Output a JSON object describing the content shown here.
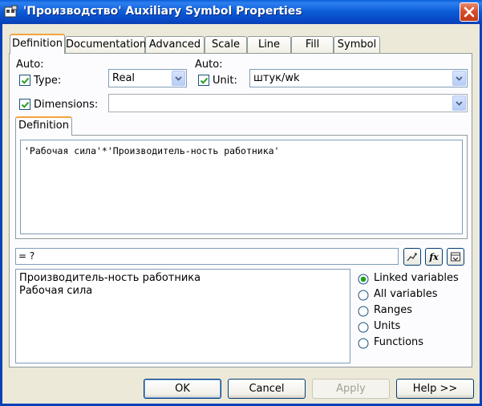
{
  "window": {
    "title": "'Производство' Auxiliary Symbol Properties"
  },
  "tabs": [
    {
      "label": "Definition",
      "active": true
    },
    {
      "label": "Documentation"
    },
    {
      "label": "Advanced"
    },
    {
      "label": "Scale"
    },
    {
      "label": "Line"
    },
    {
      "label": "Fill"
    },
    {
      "label": "Symbol"
    }
  ],
  "definition": {
    "auto_label_left": "Auto:",
    "auto_label_right": "Auto:",
    "type_label": "Type:",
    "type_checked": true,
    "type_value": "Real",
    "unit_label": "Unit:",
    "unit_checked": true,
    "unit_value": "штук/wk",
    "dimensions_label": "Dimensions:",
    "dimensions_checked": true,
    "dimensions_value": "",
    "inner_tab": "Definition",
    "equation": "'Рабочая сила'*'Производитель-ность работника'",
    "result": "= ?",
    "variables": [
      "Производитель-ность работника",
      "Рабочая сила"
    ],
    "radio_options": [
      {
        "label": "Linked variables",
        "selected": true
      },
      {
        "label": "All variables",
        "selected": false
      },
      {
        "label": "Ranges",
        "selected": false
      },
      {
        "label": "Units",
        "selected": false
      },
      {
        "label": "Functions",
        "selected": false
      }
    ]
  },
  "buttons": {
    "ok": "OK",
    "cancel": "Cancel",
    "apply": "Apply",
    "help": "Help >>"
  },
  "colors": {
    "titlebar": "#0b5ad6",
    "active_tab_accent": "#f5a33a",
    "radio_selected": "#20a020"
  }
}
